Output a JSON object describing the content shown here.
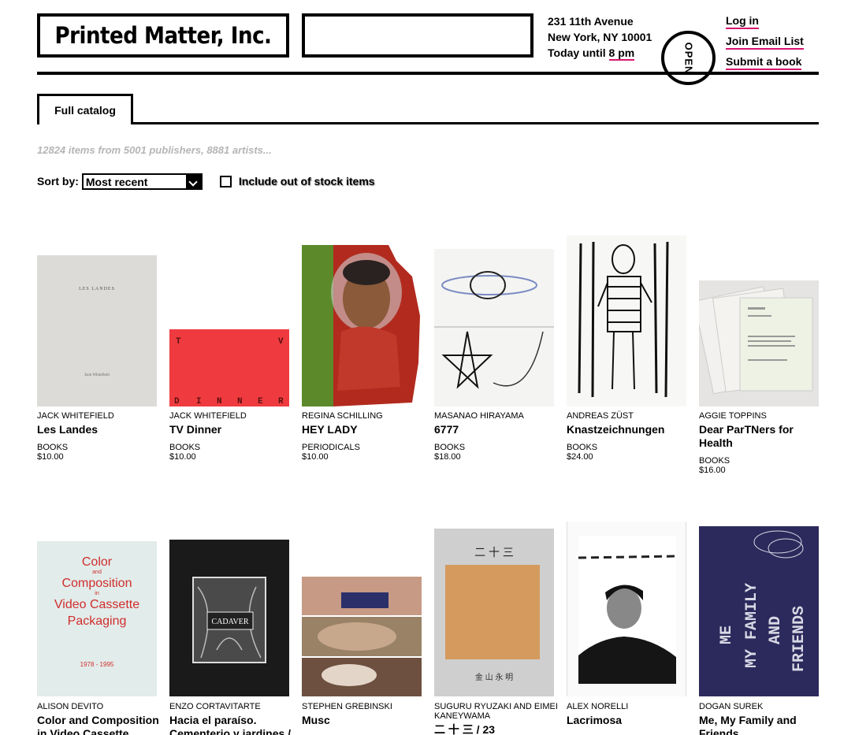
{
  "header": {
    "logo": "Printed Matter, Inc.",
    "search_placeholder": "",
    "address_line1": "231 11th Avenue",
    "address_line2": "New York, NY 10001",
    "hours_prefix": "Today until ",
    "hours_time": "8 pm",
    "open_badge": "OPEN",
    "links": {
      "login": "Log in",
      "join": "Join Email List",
      "submit": "Submit a book"
    }
  },
  "tabs": [
    {
      "label": "Full catalog"
    }
  ],
  "summary": "12824 items from 5001 publishers, 8881 artists...",
  "sort": {
    "label": "Sort by:",
    "selected": "Most recent"
  },
  "out_of_stock": {
    "label": "Include out of stock items",
    "checked": false
  },
  "products": [
    {
      "artist": "JACK WHITEFIELD",
      "title": "Les Landes",
      "category": "BOOKS",
      "price": "$10.00",
      "cover_text": "LES LANDES",
      "cover_sub": "Jack Whitefield"
    },
    {
      "artist": "JACK WHITEFIELD",
      "title": "TV Dinner",
      "category": "BOOKS",
      "price": "$10.00",
      "cover_text": "T V D I N N E R"
    },
    {
      "artist": "REGINA SCHILLING",
      "title": "HEY LADY",
      "category": "PERIODICALS",
      "price": "$10.00"
    },
    {
      "artist": "MASANAO HIRAYAMA",
      "title": "6777",
      "category": "BOOKS",
      "price": "$18.00"
    },
    {
      "artist": "ANDREAS ZÜST",
      "title": "Knastzeichnungen",
      "category": "BOOKS",
      "price": "$24.00"
    },
    {
      "artist": "AGGIE TOPPINS",
      "title": "Dear ParTNers for Health",
      "category": "BOOKS",
      "price": "$16.00"
    },
    {
      "artist": "ALISON DEVITO",
      "title": "Color and Composition in Video Cassette Packaging",
      "category": "",
      "price": "",
      "cover_lines": [
        "Color",
        "and",
        "Composition",
        "in",
        "Video Cassette",
        "Packaging",
        "1978 - 1995"
      ]
    },
    {
      "artist": "ENZO CORTAVITARTE",
      "title": "Hacia el paraíso. Cementerio y jardines / Cadaver en la capital",
      "category": "",
      "price": "",
      "cover_text": "HACIA EL PARAISO CADAVER EN LA CAPITAL"
    },
    {
      "artist": "STEPHEN GREBINSKI",
      "title": "Musc",
      "category": "",
      "price": ""
    },
    {
      "artist": "SUGURU RYUZAKI AND EIMEI KANEYWAMA",
      "title": "二 十 三 / 23",
      "category": "",
      "price": "",
      "cover_top": "二  十  三",
      "cover_bottom": "金  山  永  明"
    },
    {
      "artist": "ALEX NORELLI",
      "title": "Lacrimosa",
      "category": "",
      "price": ""
    },
    {
      "artist": "DOGAN SUREK",
      "title": "Me, My Family and Friends",
      "category": "",
      "price": "",
      "cover_text": "ME MY FAMILY AND FRIENDS"
    }
  ],
  "colors": {
    "accent": "#d6166e",
    "summary_gray": "#b5b5b5"
  }
}
